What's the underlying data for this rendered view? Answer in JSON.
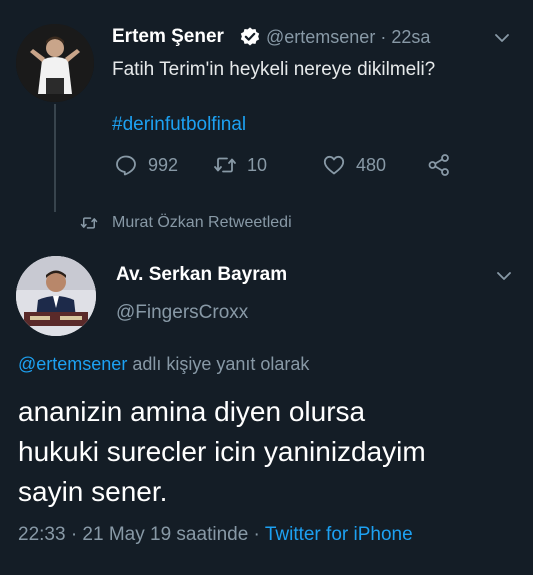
{
  "tweet1": {
    "name": "Ertem Şener",
    "handle": "@ertemsener",
    "separator": "·",
    "time": "22sa",
    "text": "Fatih Terim'in heykeli nereye dikilmeli?",
    "hashtag": "#derinfutbolfinal",
    "actions": {
      "replies": "992",
      "retweets": "10",
      "likes": "480"
    },
    "icons": {
      "verified": "verified-badge-icon",
      "menu": "chevron-down-icon",
      "reply": "reply-icon",
      "retweet": "retweet-icon",
      "like": "heart-icon",
      "share": "share-icon"
    }
  },
  "retweet_context": {
    "text": "Murat Özkan Retweetledi",
    "icon": "retweet-icon"
  },
  "tweet2": {
    "name": "Av. Serkan Bayram",
    "handle": "@FingersCroxx",
    "reply_to_handle": "@ertemsener",
    "reply_to_suffix": " adlı kişiye yanıt olarak",
    "lines": [
      "ananizin amina diyen olursa",
      "hukuki surecler icin yaninizdayim",
      "sayin sener."
    ],
    "timestamp": "22:33 · 21 May 19 saatinde ·",
    "source": "Twitter for iPhone",
    "icons": {
      "menu": "chevron-down-icon"
    }
  },
  "colors": {
    "background": "#141d26",
    "accent": "#1da1f2",
    "muted": "#8899a6",
    "text": "#ffffff"
  }
}
